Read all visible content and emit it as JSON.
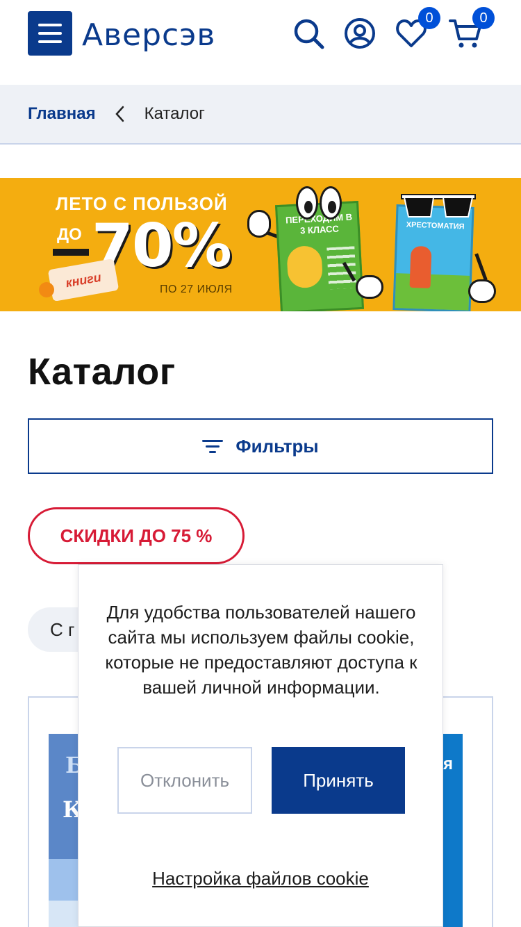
{
  "header": {
    "logo_text": "Аверсэв",
    "icons": [
      "menu-icon",
      "search-icon",
      "user-icon",
      "heart-icon",
      "cart-icon"
    ],
    "favorites_count": "0",
    "cart_count": "0",
    "brand_color": "#0a3a8c"
  },
  "breadcrumb": {
    "home": "Главная",
    "current": "Каталог"
  },
  "banner": {
    "line1": "ЛЕТО С ПОЛЬЗОЙ",
    "prefix": "ДО",
    "discount": "70%",
    "tag": "книги",
    "date": "ПО 27 ИЮЛЯ",
    "book1_title": "ПЕРЕХОДИМ В 3 КЛАСС",
    "book2_title": "ХРЕСТОМАТИЯ",
    "background_color": "#f4ad10"
  },
  "page": {
    "title": "Каталог"
  },
  "filters": {
    "label": "Фильтры"
  },
  "sale_chip": {
    "label": "СКИДКИ ДО 75 %",
    "color": "#d71b36"
  },
  "sort_chip": {
    "label": "С г"
  },
  "product": {
    "image_text1": "Б",
    "image_text2": "К",
    "image_text_right": "я"
  },
  "cookie": {
    "message": "Для удобства пользователей нашего сайта мы используем файлы cookie, которые не предоставляют доступа к вашей личной информации.",
    "decline_label": "Отклонить",
    "accept_label": "Принять",
    "settings_label": "Настройка файлов cookie"
  }
}
